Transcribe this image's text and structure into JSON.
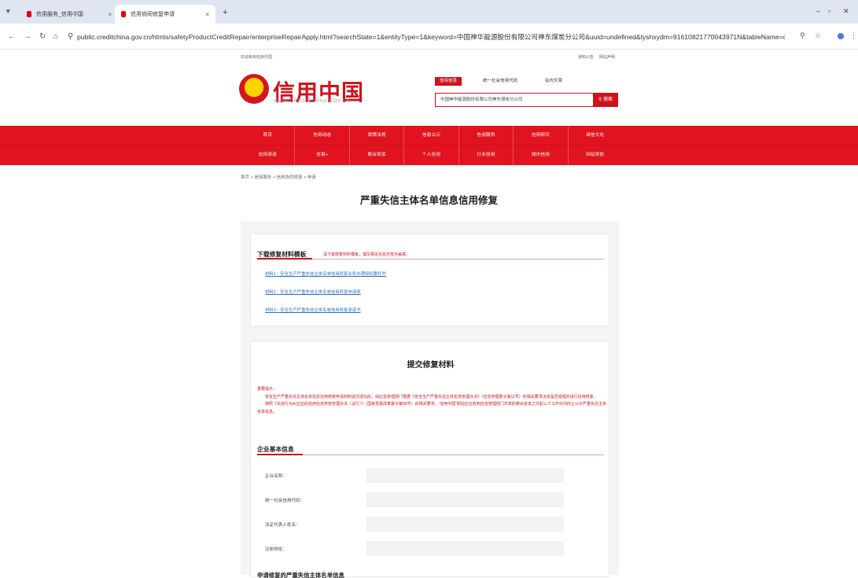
{
  "browser": {
    "tabs": [
      {
        "label": "信用服务_信用中国",
        "active": false
      },
      {
        "label": "信用协同修复申请",
        "active": true
      }
    ],
    "new_tab": "+",
    "url": "public.creditchina.gov.cn/htmls/safetyProductCreditRepair/enterpriseRepairApply.html?searchState=1&entityType=1&keyword=中国神华能源股份有限公司神东煤炭分公司&uuid=undefined&tyshxydm=91610821770043971N&tableName=credit_yjglb_fr_a..."
  },
  "site": {
    "top_left": "欢迎来到信用中国",
    "top_right": [
      "通知公告",
      "网站声明"
    ],
    "logo_title": "信用中国",
    "logo_sub": "WWW.CREDITCHINA.GOV.CN",
    "search_tabs": [
      "信用信息",
      "统一社会信用代码",
      "站内文章"
    ],
    "search_value": "中国神华能源股份有限公司神东煤炭分公司",
    "search_button": "搜索",
    "nav_row1": [
      "首页",
      "信用动态",
      "政策法规",
      "信息公示",
      "信用服务",
      "信用研究",
      "诚信文化"
    ],
    "nav_row2": [
      "信用承诺",
      "信易+",
      "联合奖惩",
      "个人信用",
      "行业信用",
      "城市信用",
      "网站导航"
    ],
    "breadcrumb": "首页 > 信用服务 > 信用协同修复 > 申请",
    "page_title": "严重失信主体名单信息信用修复"
  },
  "download": {
    "heading": "下载修复材料模板",
    "hint": "请下载修复材料模板，填写相关信息并签字盖章。",
    "links": [
      "材料1：安全生产严重失信主体名单信用修复业务办理授权委托书",
      "材料2：安全生产严重失信主体名单信用修复申请表",
      "材料3：安全生产严重失信主体名单信用修复承诺书"
    ]
  },
  "submit": {
    "title": "提交修复材料",
    "notice": [
      "重要提示：",
      "　　安全生产严重失信主体名单信息信用修复申请材料提交成功后，由应急管理部门根据《安全生产严重失信主体名单管理办法》（应急管理部令第11号）的相关要求决定是否受理并进行信用修复。",
      "　　按照《失信行为纠正后的信用信息修复管理办法（试行）》（国家发展改革委令第58号）的相关要求，“信用中国”网站应在收到应急管理部门共享的移出名单之日起三个工作日内终止公示严重失信主体名单信息。"
    ],
    "basic_heading": "企业基本信息",
    "fields": [
      {
        "label": "企业名称：",
        "value": ""
      },
      {
        "label": "统一社会信用代码：",
        "value": ""
      },
      {
        "label": "法定代表人姓名：",
        "value": ""
      },
      {
        "label": "注册地址：",
        "value": ""
      }
    ],
    "next_heading": "申请修复的严重失信主体名单信息"
  }
}
